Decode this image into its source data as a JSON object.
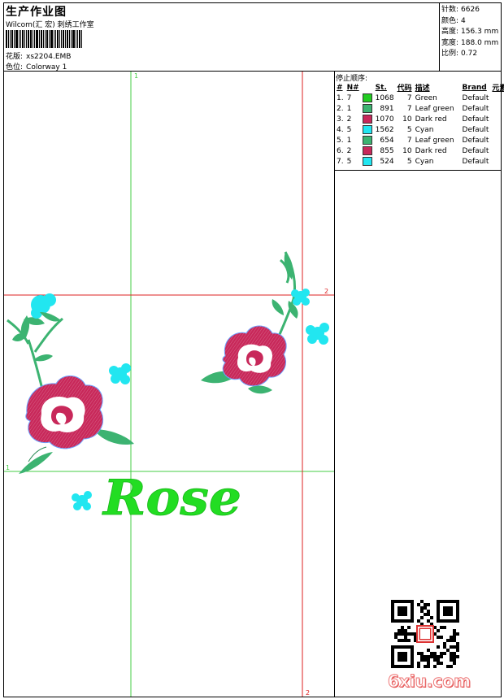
{
  "header": {
    "title": "生产作业图",
    "subtitle": "Wilcom(汇 宏) 刺绣工作室",
    "design_label": "花版:",
    "design_value": "xs2204.EMB",
    "colorway_label": "色位:",
    "colorway_value": "Colorway 1"
  },
  "stats": [
    {
      "label": "针数:",
      "value": "6626"
    },
    {
      "label": "颜色:",
      "value": "4"
    },
    {
      "label": "高度:",
      "value": "156.3 mm"
    },
    {
      "label": "宽度:",
      "value": "188.0 mm"
    },
    {
      "label": "比例:",
      "value": "0.72"
    }
  ],
  "sequence": {
    "title": "停止顺序:",
    "columns": [
      "#",
      "N#",
      "St.",
      "代码",
      "描述",
      "Brand",
      "元素"
    ],
    "rows": [
      {
        "idx": "1.",
        "n": "7",
        "color": "#22cc22",
        "st": "1068",
        "code": "7",
        "desc": "Green",
        "brand": "Default"
      },
      {
        "idx": "2.",
        "n": "1",
        "color": "#3cb371",
        "st": "891",
        "code": "7",
        "desc": "Leaf green",
        "brand": "Default"
      },
      {
        "idx": "3.",
        "n": "2",
        "color": "#c8285a",
        "st": "1070",
        "code": "10",
        "desc": "Dark red",
        "brand": "Default"
      },
      {
        "idx": "4.",
        "n": "5",
        "color": "#22e6f0",
        "st": "1562",
        "code": "5",
        "desc": "Cyan",
        "brand": "Default"
      },
      {
        "idx": "5.",
        "n": "1",
        "color": "#3cb371",
        "st": "654",
        "code": "7",
        "desc": "Leaf green",
        "brand": "Default"
      },
      {
        "idx": "6.",
        "n": "2",
        "color": "#c8285a",
        "st": "855",
        "code": "10",
        "desc": "Dark red",
        "brand": "Default"
      },
      {
        "idx": "7.",
        "n": "5",
        "color": "#22e6f0",
        "st": "524",
        "code": "5",
        "desc": "Cyan",
        "brand": "Default"
      }
    ]
  },
  "design": {
    "text": "Rose",
    "guide_labels": {
      "green_v": "1",
      "green_h": "1",
      "red_v": "2",
      "red_h": "2"
    }
  },
  "watermark": "6xiu.com",
  "colors": {
    "green": "#22cc22",
    "leaf": "#3cb371",
    "red": "#c8285a",
    "cyan": "#22e6f0",
    "guide_green": "#44cc44",
    "guide_red": "#dd2222"
  }
}
